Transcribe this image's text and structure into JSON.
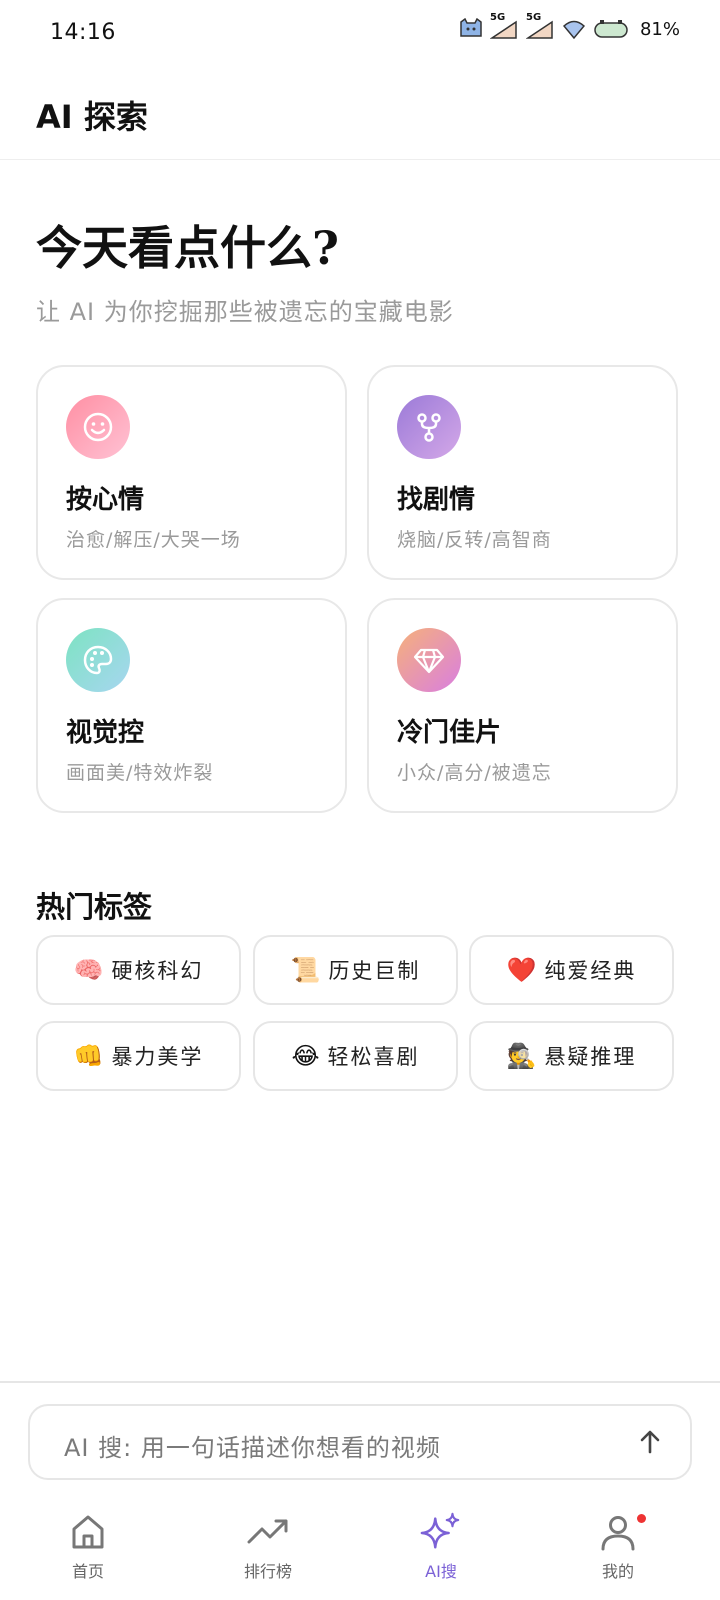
{
  "status_bar": {
    "time": "14:16",
    "network_1": "5G",
    "network_2": "5G",
    "battery": "81%"
  },
  "header": {
    "title": "AI 探索"
  },
  "hero": {
    "title": "今天看点什么?",
    "subtitle": "让 AI 为你挖掘那些被遗忘的宝藏电影"
  },
  "cards": [
    {
      "icon": "smile-icon",
      "title": "按心情",
      "desc": "治愈/解压/大哭一场",
      "gradient": [
        "#ff8fa3",
        "#ffc2d4"
      ]
    },
    {
      "icon": "fork-icon",
      "title": "找剧情",
      "desc": "烧脑/反转/高智商",
      "gradient": [
        "#9b7ad8",
        "#d4a8e8"
      ]
    },
    {
      "icon": "palette-icon",
      "title": "视觉控",
      "desc": "画面美/特效炸裂",
      "gradient": [
        "#7de3c2",
        "#a7d6f0"
      ]
    },
    {
      "icon": "diamond-icon",
      "title": "冷门佳片",
      "desc": "小众/高分/被遗忘",
      "gradient": [
        "#f6b17a",
        "#d97ee0"
      ]
    }
  ],
  "hot_tags": {
    "title": "热门标签",
    "items": [
      {
        "emoji": "🧠",
        "label": "硬核科幻"
      },
      {
        "emoji": "📜",
        "label": "历史巨制"
      },
      {
        "emoji": "❤️",
        "label": "纯爱经典"
      },
      {
        "emoji": "👊",
        "label": "暴力美学"
      },
      {
        "emoji": "😂",
        "label": "轻松喜剧"
      },
      {
        "emoji": "🕵️",
        "label": "悬疑推理"
      }
    ]
  },
  "search": {
    "placeholder": "AI 搜: 用一句话描述你想看的视频"
  },
  "nav": [
    {
      "label": "首页",
      "icon": "home-icon"
    },
    {
      "label": "排行榜",
      "icon": "trending-icon"
    },
    {
      "label": "AI搜",
      "icon": "sparkles-icon",
      "active": true
    },
    {
      "label": "我的",
      "icon": "user-icon",
      "notification": true
    }
  ],
  "colors": {
    "accent": "#7b61d6",
    "notification": "#ee3333"
  }
}
